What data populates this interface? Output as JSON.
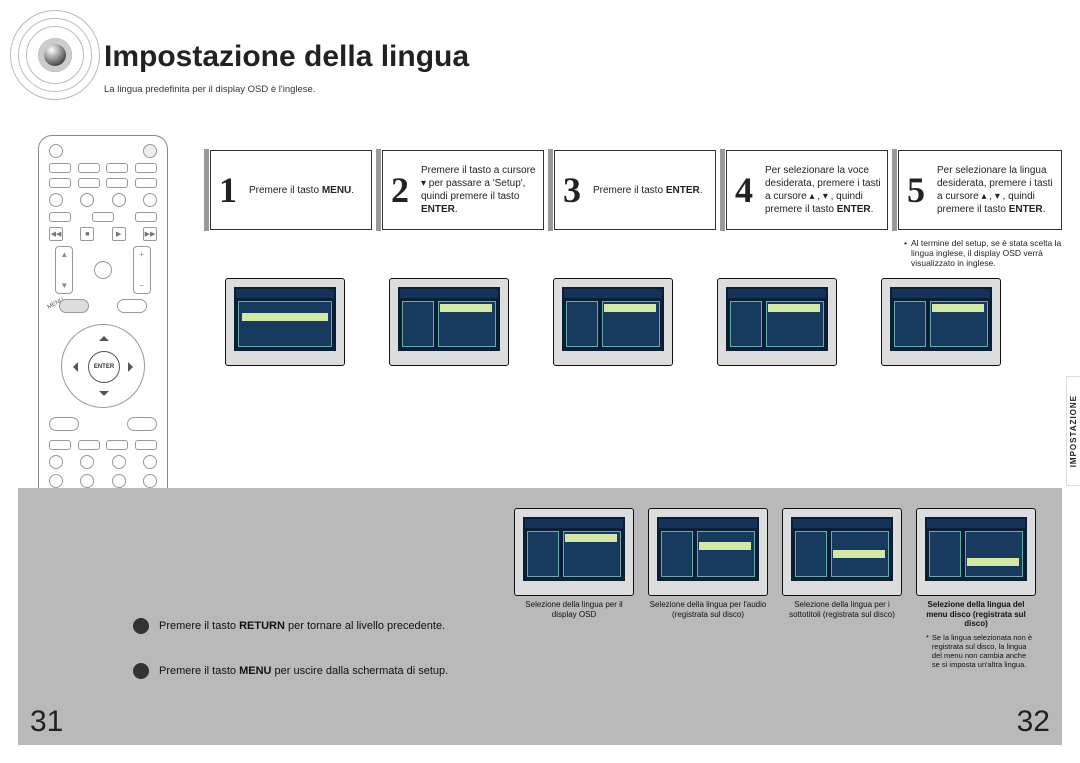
{
  "title": "Impostazione della lingua",
  "subtitle": "La lingua predefinita per il display OSD è l'inglese.",
  "remote_enter_label": "ENTER",
  "steps": [
    {
      "num": "1",
      "pre": "Premere il tasto ",
      "bold": "MENU",
      "post": "."
    },
    {
      "num": "2",
      "pre": "Premere il tasto a cursore ▾ per passare a 'Setup', quindi premere il tasto ",
      "bold": "ENTER",
      "post": "."
    },
    {
      "num": "3",
      "pre": "Premere il tasto ",
      "bold": "ENTER",
      "post": "."
    },
    {
      "num": "4",
      "pre": "Per selezionare la voce desiderata, premere i tasti a cursore ▴ , ▾ , quindi premere il tasto ",
      "bold": "ENTER",
      "post": "."
    },
    {
      "num": "5",
      "pre": "Per selezionare la lingua desiderata, premere i tasti a cursore ▴ , ▾ , quindi premere il tasto ",
      "bold": "ENTER",
      "post": "."
    }
  ],
  "step5_note": "Al termine del setup, se è stata scelta la lingua inglese, il display OSD verrà visualizzato in inglese.",
  "notes": {
    "return": {
      "pre": "Premere il tasto ",
      "bold": "RETURN",
      "post": " per tornare al livello precedente."
    },
    "menu": {
      "pre": "Premere il tasto ",
      "bold": "MENU",
      "post": " per uscire dalla schermata di setup."
    }
  },
  "bottom_caps": [
    "Selezione della lingua per il display OSD",
    "Selezione della lingua per l'audio (registrata sul disco)",
    "Selezione della lingua per i sottotitoli (registrata sul disco)",
    "Selezione della lingua del menu disco (registrata sul disco)"
  ],
  "bottom_footnote": "Se la lingua selezionata non è registrata sul disco, la lingua del menu non cambia anche se si imposta un'altra lingua.",
  "side_tab": "IMPOSTAZIONE",
  "page_left": "31",
  "page_right": "32"
}
